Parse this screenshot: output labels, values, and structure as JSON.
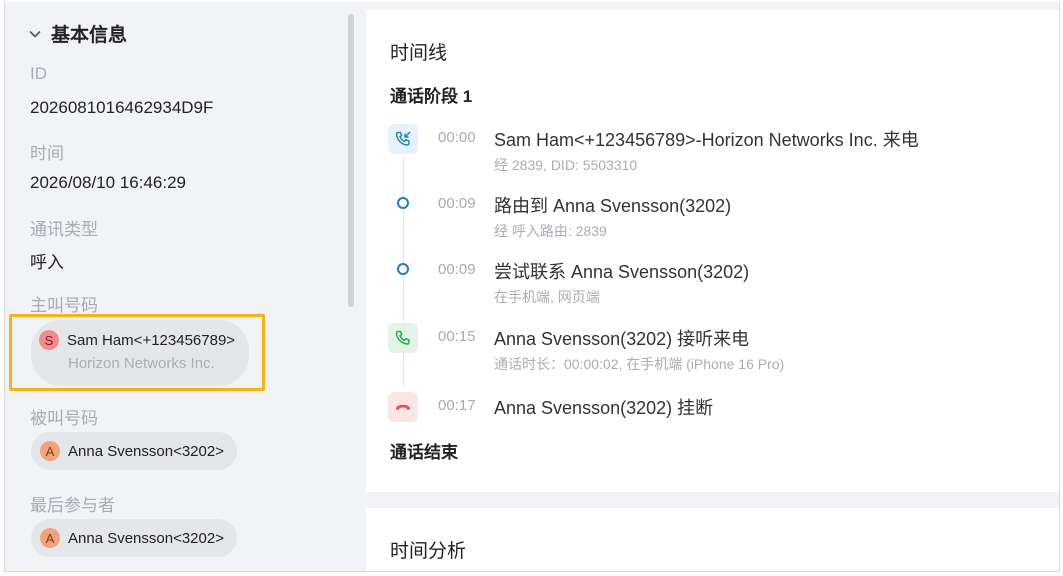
{
  "basic_info": {
    "title": "基本信息",
    "id_label": "ID",
    "id_value": "2026081016462934D9F",
    "time_label": "时间",
    "time_value": "2026/08/10 16:46:29",
    "type_label": "通讯类型",
    "type_value": "呼入",
    "caller_label": "主叫号码",
    "caller": {
      "avatar": "S",
      "name": "Sam Ham<+123456789>",
      "company": "Horizon Networks Inc."
    },
    "callee_label": "被叫号码",
    "callee": {
      "avatar": "A",
      "name": "Anna Svensson<3202>"
    },
    "last_label": "最后参与者",
    "last": {
      "avatar": "A",
      "name": "Anna Svensson<3202>"
    }
  },
  "timeline": {
    "title": "时间线",
    "stage": "通话阶段 1",
    "events": [
      {
        "icon": "incoming-call-icon",
        "time": "00:00",
        "main": "Sam Ham<+123456789>-Horizon Networks Inc. 来电",
        "sub": "经 2839, DID: 5503310"
      },
      {
        "icon": "dot",
        "time": "00:09",
        "main": "路由到 Anna Svensson(3202)",
        "sub": "经 呼入路由: 2839"
      },
      {
        "icon": "dot",
        "time": "00:09",
        "main": "尝试联系 Anna Svensson(3202)",
        "sub": "在手机端, 网页端"
      },
      {
        "icon": "answer-call-icon",
        "time": "00:15",
        "main": "Anna Svensson(3202) 接听来电",
        "sub": "通话时长：00:00:02, 在手机端 (iPhone 16 Pro)"
      },
      {
        "icon": "hangup-icon",
        "time": "00:17",
        "main": "Anna Svensson(3202) 挂断",
        "sub": ""
      }
    ],
    "end": "通话结束"
  },
  "analysis": {
    "title": "时间分析"
  },
  "colors": {
    "accent_blue": "#1f7ec1",
    "answer_green": "#2ba84a",
    "hangup_red": "#e05252",
    "highlight": "#f2b418"
  }
}
